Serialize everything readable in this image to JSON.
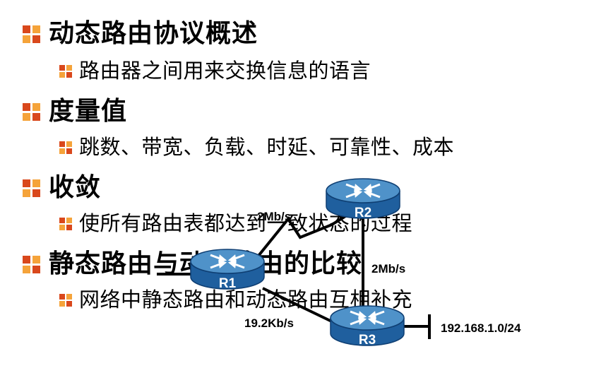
{
  "colors": {
    "bullet_dark": "#d9481c",
    "bullet_light": "#f5a33a",
    "router_top": "#4f92c9",
    "router_side": "#1f5f9e",
    "router_edge": "#0f3f73",
    "link": "#000000"
  },
  "outline": [
    {
      "text": "动态路由协议概述",
      "children": [
        "路由器之间用来交换信息的语言"
      ]
    },
    {
      "text": "度量值",
      "children": [
        "跳数、带宽、负载、时延、可靠性、成本"
      ]
    },
    {
      "text": "收敛",
      "children": [
        "使所有路由表都达到一致状态的过程"
      ]
    },
    {
      "text": "静态路由与动态路由的比较",
      "children": [
        "网络中静态路由和动态路由互相补充"
      ]
    }
  ],
  "topology": {
    "routers": [
      {
        "id": "R1",
        "label": "R1",
        "icon": "router-icon"
      },
      {
        "id": "R2",
        "label": "R2",
        "icon": "router-icon"
      },
      {
        "id": "R3",
        "label": "R3",
        "icon": "router-icon"
      }
    ],
    "links": [
      {
        "from": "R1",
        "to": "R2",
        "label": "2Mb/s"
      },
      {
        "from": "R2",
        "to": "R3",
        "label": "2Mb/s"
      },
      {
        "from": "R1",
        "to": "R3",
        "label": "19.2Kb/s"
      }
    ],
    "network_label": "192.168.1.0/24"
  }
}
